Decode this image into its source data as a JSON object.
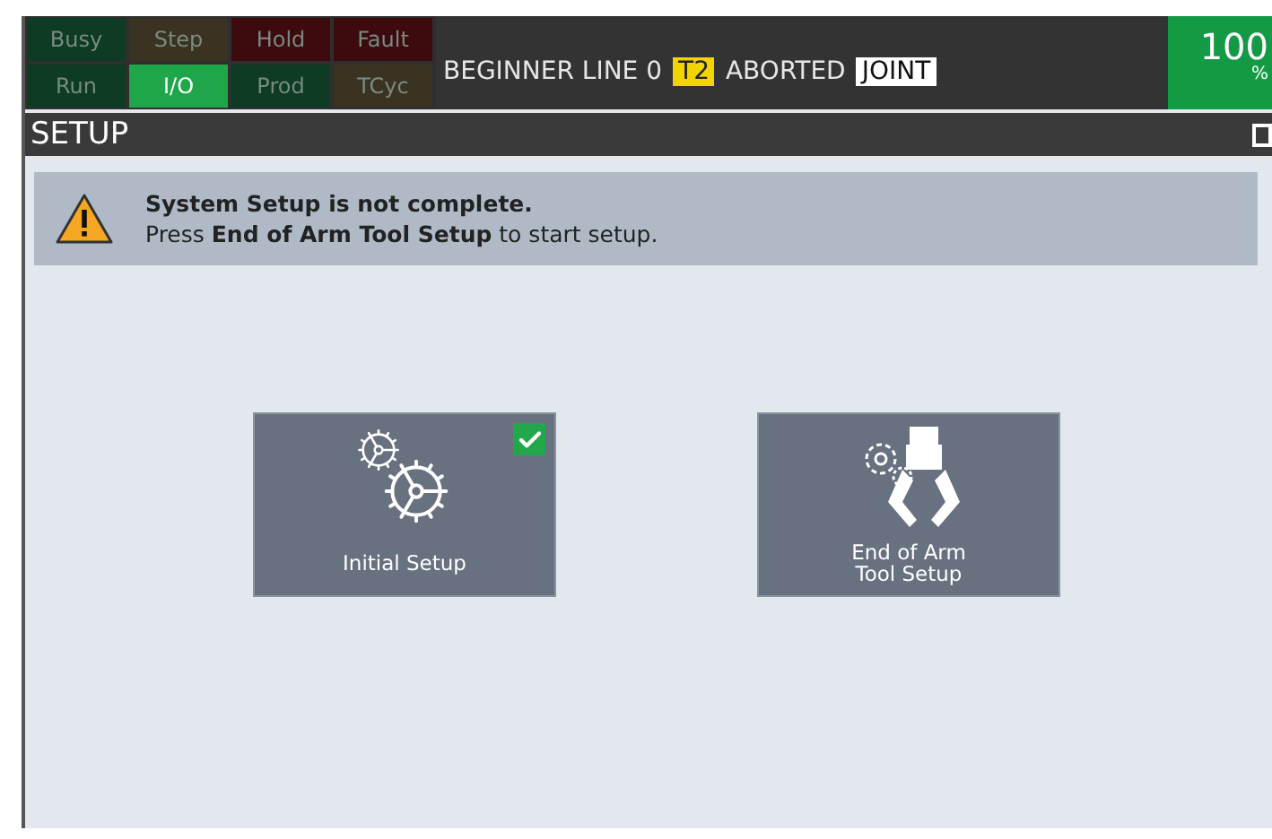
{
  "status_lamps": [
    {
      "label": "Busy",
      "color": "#0d3b24",
      "on": false
    },
    {
      "label": "Step",
      "color": "#3b3322",
      "on": false
    },
    {
      "label": "Hold",
      "color": "#3d0b0d",
      "on": false
    },
    {
      "label": "Fault",
      "color": "#3d0b0d",
      "on": false
    },
    {
      "label": "Run",
      "color": "#0d3b24",
      "on": false
    },
    {
      "label": "I/O",
      "color": "#1fa64a",
      "on": true
    },
    {
      "label": "Prod",
      "color": "#0d3b24",
      "on": false
    },
    {
      "label": "TCyc",
      "color": "#3b3322",
      "on": false
    }
  ],
  "status_line": {
    "program": "BEGINNER LINE 0",
    "mode": "T2",
    "state": "ABORTED",
    "coord": "JOINT"
  },
  "override": {
    "value": "100",
    "unit": "%"
  },
  "screen_title": "SETUP",
  "alert": {
    "title": "System Setup is not complete.",
    "message": "Press **End of Arm Tool Setup** to start setup."
  },
  "setup_buttons": [
    {
      "kind": "gears",
      "label": "Initial Setup",
      "completed": true
    },
    {
      "kind": "gripper",
      "label": "End of Arm\nTool Setup",
      "completed": false
    }
  ]
}
